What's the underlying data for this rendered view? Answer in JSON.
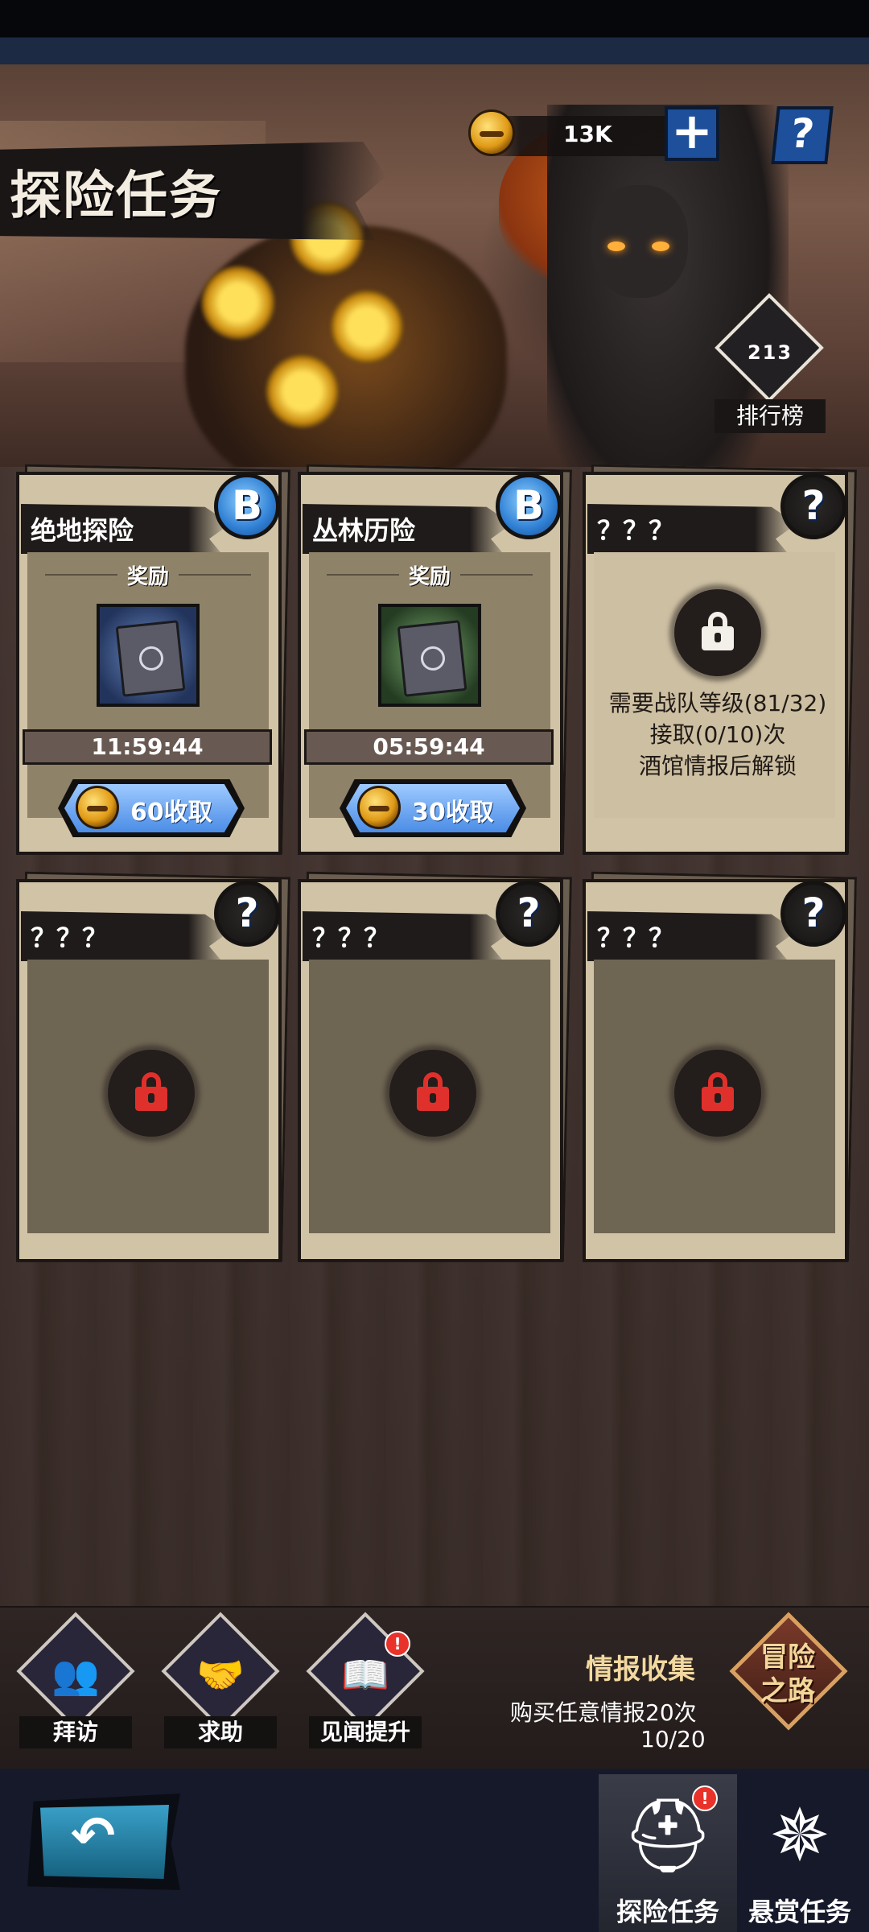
{
  "header": {
    "title": "探险任务",
    "currency_amount": "13K",
    "currency_icon": "gold-coin-icon",
    "add_icon": "+",
    "help_icon": "?",
    "ranking": {
      "label": "排行榜",
      "digits": "213"
    }
  },
  "missions": [
    {
      "name": "绝地探险",
      "grade": "B",
      "reward_label": "奖励",
      "reward_item": "blue-book-icon",
      "timer": "11:59:44",
      "collect_label": "60收取"
    },
    {
      "name": "丛林历险",
      "grade": "B",
      "reward_label": "奖励",
      "reward_item": "green-book-icon",
      "timer": "05:59:44",
      "collect_label": "30收取"
    },
    {
      "name": "？？？",
      "grade": "?",
      "requirements": [
        "需要战队等级(81/32)",
        "接取(0/10)次",
        "酒馆情报后解锁"
      ]
    },
    {
      "name": "？？？",
      "grade": "?"
    },
    {
      "name": "？？？",
      "grade": "?"
    },
    {
      "name": "？？？",
      "grade": "?"
    }
  ],
  "actions": [
    {
      "label": "拜访",
      "icon": "people-icon",
      "glyph": "👥"
    },
    {
      "label": "求助",
      "icon": "handshake-icon",
      "glyph": "🤝"
    },
    {
      "label": "见闻提升",
      "icon": "book-icon",
      "glyph": "📖",
      "badge": "!"
    }
  ],
  "intel": {
    "title": "情报收集",
    "description": "购买任意情报20次",
    "progress": "10/20",
    "progress_current": 10,
    "progress_total": 20
  },
  "adventure_road": {
    "line1": "冒险",
    "line2": "之路"
  },
  "nav": {
    "back_icon": "↶",
    "tabs": [
      {
        "label": "探险任务",
        "icon": "knight-helmet-icon",
        "glyph": "⛑",
        "active": true,
        "badge": "!"
      },
      {
        "label": "悬赏任务",
        "icon": "compass-star-icon",
        "glyph": "✵",
        "active": false
      }
    ]
  },
  "colors": {
    "grade_blue": "#2f7fd4",
    "button_blue": "#4a8ce6",
    "lock_red": "#e0302c",
    "lock_white": "#f3f0ea",
    "badge_red": "#e8322a"
  }
}
